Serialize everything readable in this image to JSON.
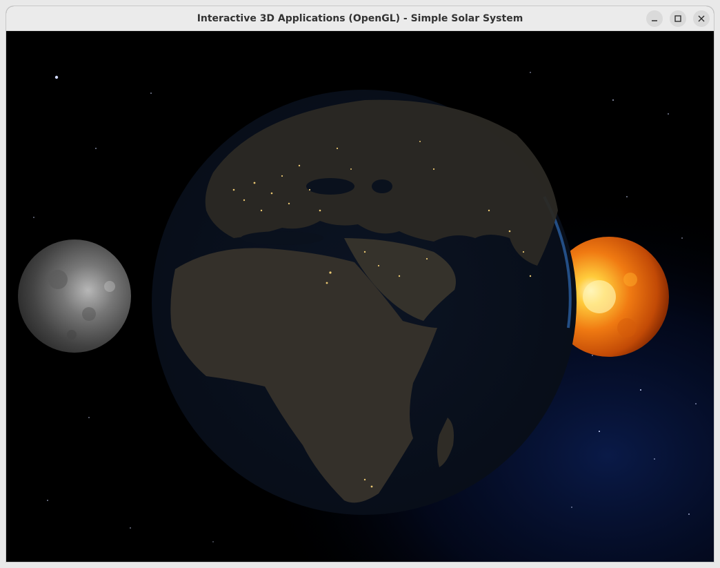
{
  "window": {
    "title": "Interactive 3D Applications (OpenGL) - Simple Solar System",
    "controls": {
      "minimize_icon": "minimize-icon",
      "maximize_icon": "maximize-icon",
      "close_icon": "close-icon"
    }
  },
  "scene": {
    "bodies": [
      {
        "name": "Moon",
        "color": "#8a8a8a"
      },
      {
        "name": "Earth",
        "color": "#2a2e30"
      },
      {
        "name": "Sun",
        "color": "#f07a12"
      }
    ],
    "background_color": "#000000",
    "nebula_color": "#0b1c4a"
  }
}
